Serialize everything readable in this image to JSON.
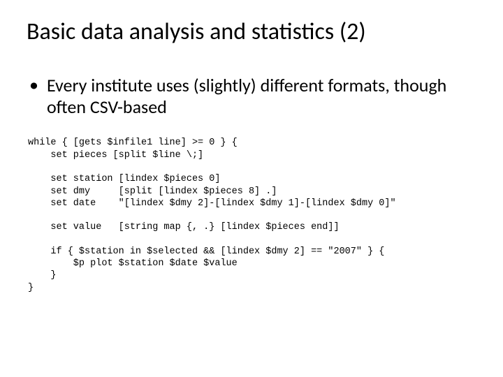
{
  "title": "Basic data analysis and statistics (2)",
  "bullet": {
    "dot": "•",
    "text": "Every institute uses (slightly) different formats, though often CSV-based"
  },
  "code": "while { [gets $infile1 line] >= 0 } {\n    set pieces [split $line \\;]\n\n    set station [lindex $pieces 0]\n    set dmy     [split [lindex $pieces 8] .]\n    set date    \"[lindex $dmy 2]-[lindex $dmy 1]-[lindex $dmy 0]\"\n\n    set value   [string map {, .} [lindex $pieces end]]\n\n    if { $station in $selected && [lindex $dmy 2] == \"2007\" } {\n        $p plot $station $date $value\n    }\n}"
}
